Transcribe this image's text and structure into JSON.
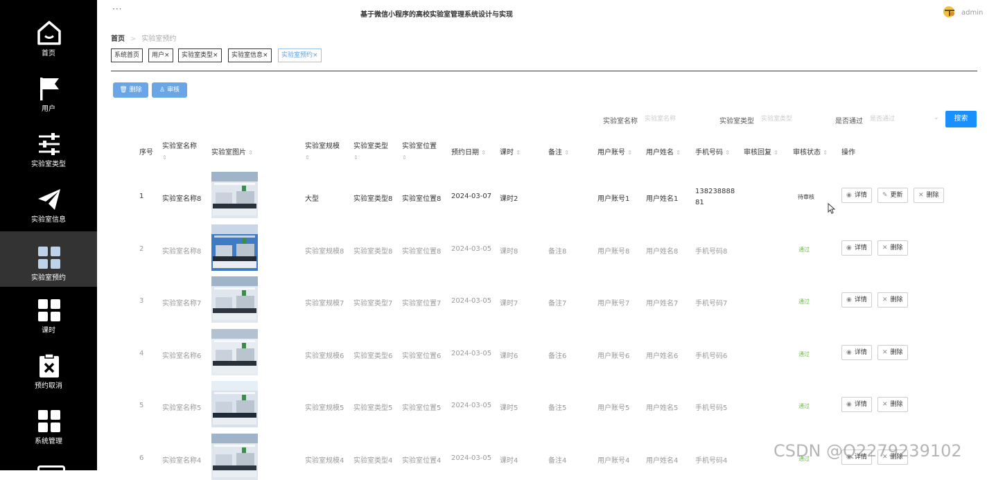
{
  "header": {
    "title": "基于微信小程序的高校实验室管理系统设计与实现",
    "user": "admin",
    "more": "···"
  },
  "sidebar": {
    "items": [
      {
        "label": "首页",
        "icon": "home-icon"
      },
      {
        "label": "用户",
        "icon": "flag-icon"
      },
      {
        "label": "实验室类型",
        "icon": "sliders-icon"
      },
      {
        "label": "实验室信息",
        "icon": "paper-plane-icon"
      },
      {
        "label": "实验室预约",
        "icon": "grid-icon",
        "active": true
      },
      {
        "label": "课时",
        "icon": "grid-icon"
      },
      {
        "label": "预约取消",
        "icon": "cancel-clipboard-icon"
      },
      {
        "label": "系统管理",
        "icon": "grid-icon"
      }
    ]
  },
  "breadcrumb": {
    "home": "首页",
    "current": "实验室预约"
  },
  "tabs": [
    {
      "label": "系统首页",
      "closable": false
    },
    {
      "label": "用户",
      "closable": true
    },
    {
      "label": "实验室类型",
      "closable": true
    },
    {
      "label": "实验室信息",
      "closable": true
    },
    {
      "label": "实验室预约",
      "closable": true,
      "active": true
    }
  ],
  "toolbar": {
    "delete": "删除",
    "audit": "审核"
  },
  "search": {
    "name_label": "实验室名称",
    "name_placeholder": "实验室名称",
    "type_label": "实验室类型",
    "type_placeholder": "实验室类型",
    "pass_label": "是否通过",
    "pass_placeholder": "是否通过",
    "button": "搜索"
  },
  "table": {
    "columns": [
      "序号",
      "实验室名称",
      "实验室图片",
      "实验室规模",
      "实验室类型",
      "实验室位置",
      "预约日期",
      "课时",
      "备注",
      "用户账号",
      "用户姓名",
      "手机号码",
      "审核回复",
      "审核状态",
      "操作"
    ],
    "rows": [
      {
        "no": "1",
        "name": "实验室名称8",
        "scale": "大型",
        "type": "实验室类型8",
        "location": "实验室位置8",
        "date": "2024-03-07",
        "period": "课时2",
        "note": "",
        "account": "用户账号1",
        "username": "用户姓名1",
        "phone": "13823888881",
        "reply": "",
        "status": "待审核",
        "status_kind": "pending",
        "actions": [
          "详情",
          "更新",
          "删除"
        ]
      },
      {
        "no": "2",
        "name": "实验室名称8",
        "scale": "实验室规模8",
        "type": "实验室类型8",
        "location": "实验室位置8",
        "date": "2024-03-05",
        "period": "课时8",
        "note": "备注8",
        "account": "用户账号8",
        "username": "用户姓名8",
        "phone": "手机号码8",
        "reply": "",
        "status": "通过",
        "status_kind": "pass",
        "actions": [
          "详情",
          "删除"
        ]
      },
      {
        "no": "3",
        "name": "实验室名称7",
        "scale": "实验室规模7",
        "type": "实验室类型7",
        "location": "实验室位置7",
        "date": "2024-03-05",
        "period": "课时7",
        "note": "备注7",
        "account": "用户账号7",
        "username": "用户姓名7",
        "phone": "手机号码7",
        "reply": "",
        "status": "通过",
        "status_kind": "pass",
        "actions": [
          "详情",
          "删除"
        ]
      },
      {
        "no": "4",
        "name": "实验室名称6",
        "scale": "实验室规模6",
        "type": "实验室类型6",
        "location": "实验室位置6",
        "date": "2024-03-05",
        "period": "课时6",
        "note": "备注6",
        "account": "用户账号6",
        "username": "用户姓名6",
        "phone": "手机号码6",
        "reply": "",
        "status": "通过",
        "status_kind": "pass",
        "actions": [
          "详情",
          "删除"
        ]
      },
      {
        "no": "5",
        "name": "实验室名称5",
        "scale": "实验室规模5",
        "type": "实验室类型5",
        "location": "实验室位置5",
        "date": "2024-03-05",
        "period": "课时5",
        "note": "备注5",
        "account": "用户账号5",
        "username": "用户姓名5",
        "phone": "手机号码5",
        "reply": "",
        "status": "通过",
        "status_kind": "pass",
        "actions": [
          "详情",
          "删除"
        ]
      },
      {
        "no": "6",
        "name": "实验室名称4",
        "scale": "实验室规模4",
        "type": "实验室类型4",
        "location": "实验室位置4",
        "date": "2024-03-05",
        "period": "课时4",
        "note": "备注4",
        "account": "用户账号4",
        "username": "用户姓名4",
        "phone": "手机号码4",
        "reply": "",
        "status": "通过",
        "status_kind": "pass",
        "actions": [
          "详情",
          "删除"
        ]
      }
    ]
  },
  "watermark": "CSDN @Q2279239102",
  "colors": {
    "sidebar_bg": "#000000",
    "sidebar_active": "#333333",
    "primary": "#1890ff",
    "toolbar_button": "#6aa5e6",
    "pending": "#f0a020",
    "pass": "#67c23a"
  }
}
